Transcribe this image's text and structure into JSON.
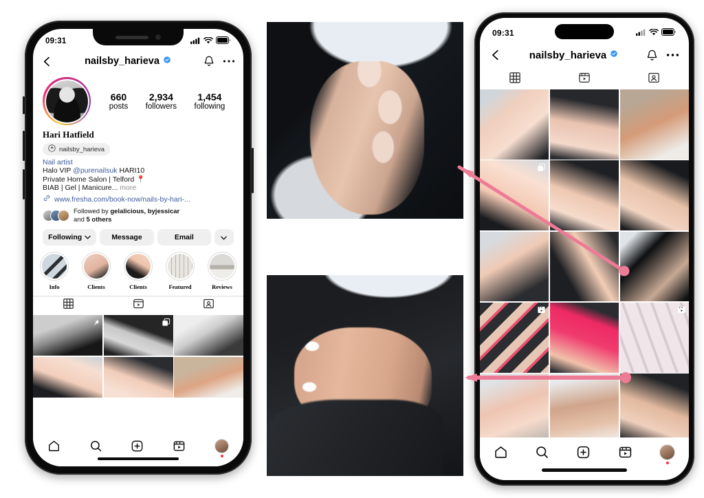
{
  "app": "Instagram",
  "left_phone": {
    "status": {
      "time": "09:31",
      "cellular": "signal-bars",
      "wifi": "wifi",
      "battery": "battery-full"
    },
    "header": {
      "back": "back-chevron",
      "username": "nailsby_harieva",
      "verified": true,
      "notifications": "bell",
      "more": "ellipsis"
    },
    "stats": [
      {
        "value": "660",
        "label": "posts"
      },
      {
        "value": "2,934",
        "label": "followers"
      },
      {
        "value": "1,454",
        "label": "following"
      }
    ],
    "profile": {
      "full_name": "Hari Hatfield",
      "threads_handle": "nailsby_harieva",
      "bio_category": "Nail artist",
      "bio_line_2_a": "Halo VIP ",
      "bio_line_2_mention": "@purenailsuk",
      "bio_line_2_b": " HARI10",
      "bio_line_3": "Private Home Salon | Telford 📍",
      "bio_line_4": "BIAB | Gel | Manicure...",
      "bio_more": " more",
      "website": "www.fresha.com/book-now/nails-by-hari-...",
      "followed_by_prefix": "Followed by ",
      "followed_by_names": "gelalicious, byjessicar",
      "followed_by_suffix_a": "and ",
      "followed_by_suffix_b": "5 others"
    },
    "actions": [
      {
        "label": "Following",
        "has_chevron": true
      },
      {
        "label": "Message",
        "has_chevron": false
      },
      {
        "label": "Email",
        "has_chevron": false
      },
      {
        "label": "",
        "has_chevron": true
      }
    ],
    "highlights": [
      {
        "label": "Info"
      },
      {
        "label": "Clients"
      },
      {
        "label": "Clients"
      },
      {
        "label": "Featured"
      },
      {
        "label": "Reviews"
      }
    ],
    "tabs": [
      {
        "name": "grid-tab",
        "icon": "grid-icon",
        "active": true
      },
      {
        "name": "reels-tab",
        "icon": "reels-icon",
        "active": false
      },
      {
        "name": "tagged-tab",
        "icon": "tagged-icon",
        "active": false
      }
    ],
    "grid": [
      {
        "alt": "portrait-selfie-bw",
        "badge": "pinned"
      },
      {
        "alt": "nails-black-glove-bw",
        "badge": "carousel"
      },
      {
        "alt": "woman-holding-baby-bw",
        "badge": "none"
      },
      {
        "alt": "french-manicure-hand",
        "badge": "none"
      },
      {
        "alt": "hand-with-ring-nails",
        "badge": "none"
      },
      {
        "alt": "pedicure-feet",
        "badge": "none"
      }
    ],
    "bottom_nav": [
      {
        "name": "home",
        "icon": "home-icon"
      },
      {
        "name": "search",
        "icon": "search-icon"
      },
      {
        "name": "create",
        "icon": "plus-square-icon"
      },
      {
        "name": "reels",
        "icon": "reels-icon"
      },
      {
        "name": "profile",
        "icon": "avatar",
        "dot": true
      }
    ]
  },
  "right_phone": {
    "status": {
      "time": "09:31",
      "cellular": "signal-bars",
      "wifi": "wifi",
      "battery": "battery-full"
    },
    "header": {
      "back": "back-chevron",
      "username": "nailsby_harieva",
      "verified": true,
      "notifications": "bell",
      "more": "ellipsis"
    },
    "tabs": [
      {
        "name": "grid-tab",
        "icon": "grid-icon",
        "active": true
      },
      {
        "name": "reels-tab",
        "icon": "reels-icon",
        "active": false
      },
      {
        "name": "tagged-tab",
        "icon": "tagged-icon",
        "active": false
      }
    ],
    "grid": [
      {
        "alt": "french-tips-hands",
        "badge": "none"
      },
      {
        "alt": "hand-ring-nude-nails",
        "badge": "none"
      },
      {
        "alt": "pedicure-french-toes",
        "badge": "none"
      },
      {
        "alt": "pink-nails-hand",
        "badge": "carousel"
      },
      {
        "alt": "two-hands-nails-dark",
        "badge": "none"
      },
      {
        "alt": "hand-black-ring-nails",
        "badge": "none"
      },
      {
        "alt": "hand-on-glove-nails",
        "badge": "none"
      },
      {
        "alt": "glove-holding-thumb",
        "badge": "none"
      },
      {
        "alt": "nude-nails-dark-bg",
        "badge": "none"
      },
      {
        "alt": "collage-pedicure",
        "badge": "reels"
      },
      {
        "alt": "bright-pink-nails",
        "badge": "none"
      },
      {
        "alt": "nail-tips-display",
        "badge": "reels"
      },
      {
        "alt": "hands-ombre-nails",
        "badge": "none"
      },
      {
        "alt": "hands-glitter-nails",
        "badge": "none"
      },
      {
        "alt": "hand-on-black-glove",
        "badge": "none"
      }
    ],
    "bottom_nav": [
      {
        "name": "home",
        "icon": "home-icon"
      },
      {
        "name": "search",
        "icon": "search-icon"
      },
      {
        "name": "create",
        "icon": "plus-square-icon"
      },
      {
        "name": "reels",
        "icon": "reels-icon"
      },
      {
        "name": "profile",
        "icon": "avatar",
        "dot": true
      }
    ]
  },
  "photos": [
    {
      "name": "photo-top",
      "alt": "closeup-natural-nails-dark-bg"
    },
    {
      "name": "photo-bottom",
      "alt": "french-manicure-on-black-glove"
    }
  ],
  "annotations": {
    "accent_color": "#ee7b96",
    "items": [
      {
        "name": "diagonal-arrow",
        "from": "grid-cell-4",
        "to": "photo-top"
      },
      {
        "name": "horizontal-arrow",
        "from": "grid-cell-15",
        "to": "photo-bottom"
      }
    ]
  }
}
